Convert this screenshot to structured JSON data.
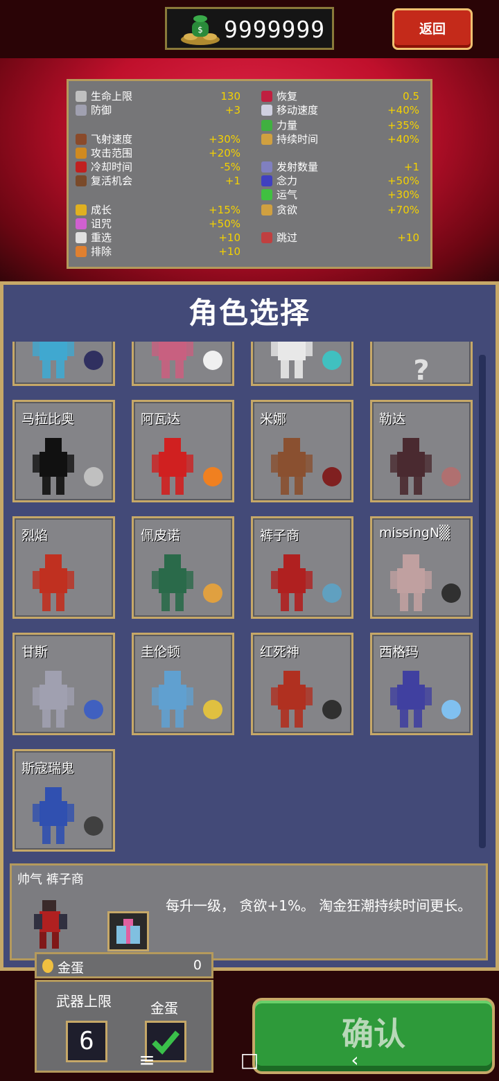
{
  "header": {
    "coins": "9999999",
    "back_label": "返回"
  },
  "stats": {
    "left": [
      {
        "label": "生命上限",
        "value": "130",
        "icon": "heart-icon",
        "color": "#c0c0c0"
      },
      {
        "label": "防御",
        "value": "+3",
        "icon": "shield-icon",
        "color": "#a0a0b0"
      },
      {
        "label": "飞射速度",
        "value": "+30%",
        "icon": "projectile-speed-icon",
        "color": "#8a4a2a"
      },
      {
        "label": "攻击范围",
        "value": "+20%",
        "icon": "area-icon",
        "color": "#d08a20"
      },
      {
        "label": "冷却时间",
        "value": "-5%",
        "icon": "cooldown-icon",
        "color": "#c02020"
      },
      {
        "label": "复活机会",
        "value": "+1",
        "icon": "revival-icon",
        "color": "#7a4a2a"
      },
      {
        "label": "成长",
        "value": "+15%",
        "icon": "growth-icon",
        "color": "#e0b020"
      },
      {
        "label": "诅咒",
        "value": "+50%",
        "icon": "curse-icon",
        "color": "#d060d0"
      },
      {
        "label": "重选",
        "value": "+10",
        "icon": "reroll-icon",
        "color": "#e0e0e0"
      },
      {
        "label": "排除",
        "value": "+10",
        "icon": "banish-icon",
        "color": "#e08030"
      }
    ],
    "right": [
      {
        "label": "恢复",
        "value": "0.5",
        "icon": "recovery-icon",
        "color": "#c02040"
      },
      {
        "label": "移动速度",
        "value": "+40%",
        "icon": "wing-icon",
        "color": "#d0d0e0"
      },
      {
        "label": "力量",
        "value": "+35%",
        "icon": "might-icon",
        "color": "#40b040"
      },
      {
        "label": "持续时间",
        "value": "+40%",
        "icon": "duration-icon",
        "color": "#d0a040"
      },
      {
        "label": "发射数量",
        "value": "+1",
        "icon": "amount-icon",
        "color": "#8080c0"
      },
      {
        "label": "念力",
        "value": "+50%",
        "icon": "magnet-icon",
        "color": "#4040c0"
      },
      {
        "label": "运气",
        "value": "+30%",
        "icon": "clover-icon",
        "color": "#40c040"
      },
      {
        "label": "贪欲",
        "value": "+70%",
        "icon": "greed-icon",
        "color": "#d0a040"
      },
      {
        "label": "跳过",
        "value": "+10",
        "icon": "skip-icon",
        "color": "#c04040"
      }
    ]
  },
  "panel": {
    "title": "角色选择"
  },
  "characters": [
    {
      "name": "",
      "sprite_color": "#40a8d0",
      "weapon_color": "#303060"
    },
    {
      "name": "",
      "sprite_color": "#c86080",
      "weapon_color": "#f0f0f0"
    },
    {
      "name": "",
      "sprite_color": "#e8e8e8",
      "weapon_color": "#40c0c0"
    },
    {
      "name": "",
      "sprite_color": "#e0e0e0",
      "weapon_color": "#848488"
    },
    {
      "name": "马拉比奥",
      "sprite_color": "#111111",
      "weapon_color": "#c0c0c0"
    },
    {
      "name": "阿瓦达",
      "sprite_color": "#d02020",
      "weapon_color": "#f08020"
    },
    {
      "name": "米娜",
      "sprite_color": "#8a5030",
      "weapon_color": "#802020"
    },
    {
      "name": "勒达",
      "sprite_color": "#4a2a30",
      "weapon_color": "#b07070"
    },
    {
      "name": "烈焰",
      "sprite_color": "#c03020",
      "weapon_color": "#848488"
    },
    {
      "name": "佩皮诺",
      "sprite_color": "#2a6a4a",
      "weapon_color": "#e0a040"
    },
    {
      "name": "裤子商",
      "sprite_color": "#b02020",
      "weapon_color": "#60a0c0"
    },
    {
      "name": "missingN▒",
      "sprite_color": "#c0a0a0",
      "weapon_color": "#303030"
    },
    {
      "name": "甘斯",
      "sprite_color": "#a0a0b0",
      "weapon_color": "#4060c0"
    },
    {
      "name": "圭伦顿",
      "sprite_color": "#60a0d0",
      "weapon_color": "#e0c040"
    },
    {
      "name": "红死神",
      "sprite_color": "#b03020",
      "weapon_color": "#303030"
    },
    {
      "name": "西格玛",
      "sprite_color": "#4040a0",
      "weapon_color": "#80c0f0"
    },
    {
      "name": "斯寇瑞鬼",
      "sprite_color": "#3050b0",
      "weapon_color": "#404040"
    }
  ],
  "info": {
    "title": "帅气 裤子商",
    "description": "每升一级， 贪欲+1%。 淘金狂潮持续时间更长。"
  },
  "egg": {
    "label": "金蛋",
    "value": "0"
  },
  "options": {
    "weapon_limit_label": "武器上限",
    "weapon_limit_value": "6",
    "golden_egg_label": "金蛋"
  },
  "confirm": {
    "label": "确认"
  },
  "navbar": {
    "menu": "≡",
    "home": "□",
    "back": "‹"
  }
}
